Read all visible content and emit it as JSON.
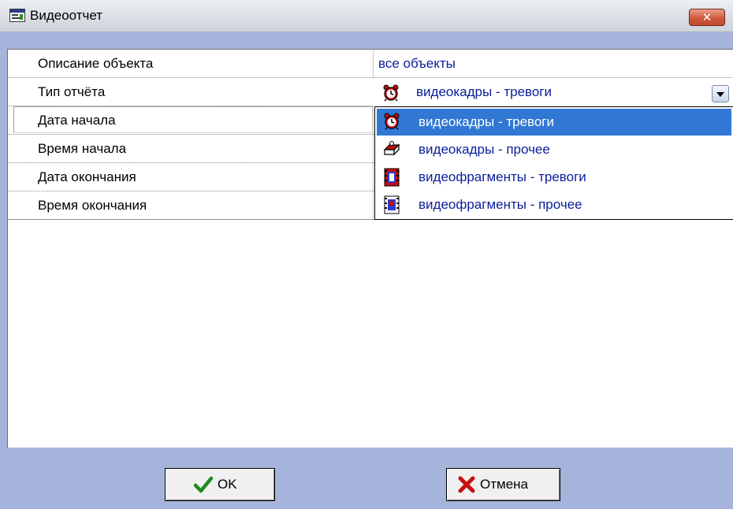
{
  "window": {
    "title": "Видеоотчет",
    "close_symbol": "✕"
  },
  "properties": [
    {
      "name": "Описание объекта",
      "value": "все объекты"
    },
    {
      "name": "Тип отчёта",
      "value": "видеокадры - тревоги"
    },
    {
      "name": "Дата начала",
      "value": ""
    },
    {
      "name": "Время начала",
      "value": ""
    },
    {
      "name": "Дата окончания",
      "value": ""
    },
    {
      "name": "Время окончания",
      "value": ""
    }
  ],
  "report_type_combo": {
    "selected": "видеокадры - тревоги",
    "options": [
      {
        "label": "видеокадры - тревоги",
        "icon": "alarm-clock-icon",
        "selected": true
      },
      {
        "label": "видеокадры - прочее",
        "icon": "camera-icon",
        "selected": false
      },
      {
        "label": "видеофрагменты - тревоги",
        "icon": "film-alarm-icon",
        "selected": false
      },
      {
        "label": "видеофрагменты - прочее",
        "icon": "film-icon",
        "selected": false
      }
    ]
  },
  "buttons": {
    "ok_label": "OK",
    "cancel_label": "Отмена"
  },
  "colors": {
    "accent": "#3178d5",
    "value_text": "#0a1e9a",
    "panel": "#a6b4dc"
  }
}
